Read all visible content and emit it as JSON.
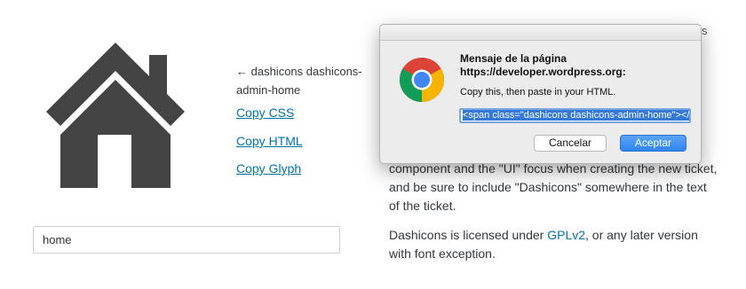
{
  "glyph": {
    "name": "← dashicons dashicons-admin-home",
    "copy_css": "Copy CSS",
    "copy_html": "Copy HTML",
    "copy_glyph": "Copy Glyph"
  },
  "search": {
    "value": "home"
  },
  "content": {
    "edge_char": "s",
    "para1": "component and the \"UI\" focus when creating the new ticket, and be sure to include \"Dashicons\" somewhere in the text of the ticket.",
    "para2_before": "Dashicons is licensed under ",
    "para2_link": "GPLv2",
    "para2_after": ", or any later version with font exception."
  },
  "dialog": {
    "title": "Mensaje de la página https://developer.wordpress.org:",
    "message": "Copy this, then paste in your HTML.",
    "input_value": "<span class=\"dashicons dashicons-admin-home\"></span>",
    "cancel_label": "Cancelar",
    "ok_label": "Aceptar"
  },
  "colors": {
    "accent": "#3478d8",
    "link": "#0073aa",
    "glyph": "#444444"
  }
}
